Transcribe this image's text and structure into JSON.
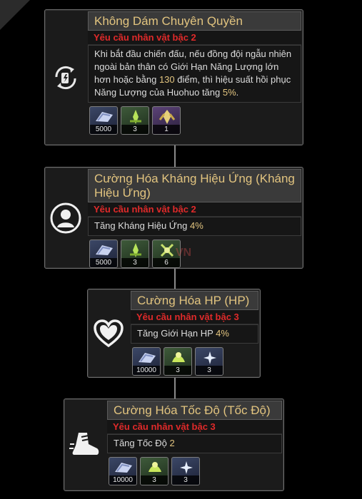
{
  "nodes": [
    {
      "icon": "energy-exchange-icon",
      "title": "Không Dám Chuyên Quyền",
      "requirement": "Yêu cầu nhân vật bậc 2",
      "description": {
        "p1": "Khi bắt đầu chiến đấu, nếu đồng đội ngẫu nhiên ngoài bản thân có Giới Hạn Năng Lượng lớn hơn hoặc bằng ",
        "v1": "130",
        "p2": " điểm, thì hiệu suất hồi phục Năng Lượng của Huohuo tăng ",
        "v2": "5%",
        "p3": "."
      },
      "materials": [
        {
          "icon": "credit-icon",
          "qty": "5000"
        },
        {
          "icon": "green-material-icon",
          "qty": "3"
        },
        {
          "icon": "purple-material-icon",
          "qty": "1"
        }
      ]
    },
    {
      "icon": "effect-resistance-icon",
      "title": "Cường Hóa Kháng Hiệu Ứng (Kháng Hiệu Ứng)",
      "requirement": "Yêu cầu nhân vật bậc 2",
      "description": {
        "text": "Tăng Kháng Hiệu Ứng ",
        "value": "4%"
      },
      "materials": [
        {
          "icon": "credit-icon",
          "qty": "5000"
        },
        {
          "icon": "green-material-icon",
          "qty": "3"
        },
        {
          "icon": "green-material-icon",
          "qty": "6"
        }
      ]
    },
    {
      "icon": "hp-heart-icon",
      "title": "Cường Hóa HP (HP)",
      "requirement": "Yêu cầu nhân vật bậc 3",
      "description": {
        "text": "Tăng Giới Hạn HP ",
        "value": "4%"
      },
      "materials": [
        {
          "icon": "credit-icon",
          "qty": "10000"
        },
        {
          "icon": "green-material-icon",
          "qty": "3"
        },
        {
          "icon": "blue-material-icon",
          "qty": "3"
        }
      ]
    },
    {
      "icon": "speed-boot-icon",
      "title": "Cường Hóa Tốc Độ (Tốc Độ)",
      "requirement": "Yêu cầu nhân vật bậc 3",
      "description": {
        "text": "Tăng Tốc Độ ",
        "value": "2"
      },
      "materials": [
        {
          "icon": "credit-icon",
          "qty": "10000"
        },
        {
          "icon": "green-material-icon",
          "qty": "3"
        },
        {
          "icon": "blue-material-icon",
          "qty": "3"
        }
      ]
    }
  ],
  "watermark": "VN",
  "colors": {
    "title": "#e2c47f",
    "requirement": "#e02a2a",
    "highlight": "#e2c47f"
  }
}
